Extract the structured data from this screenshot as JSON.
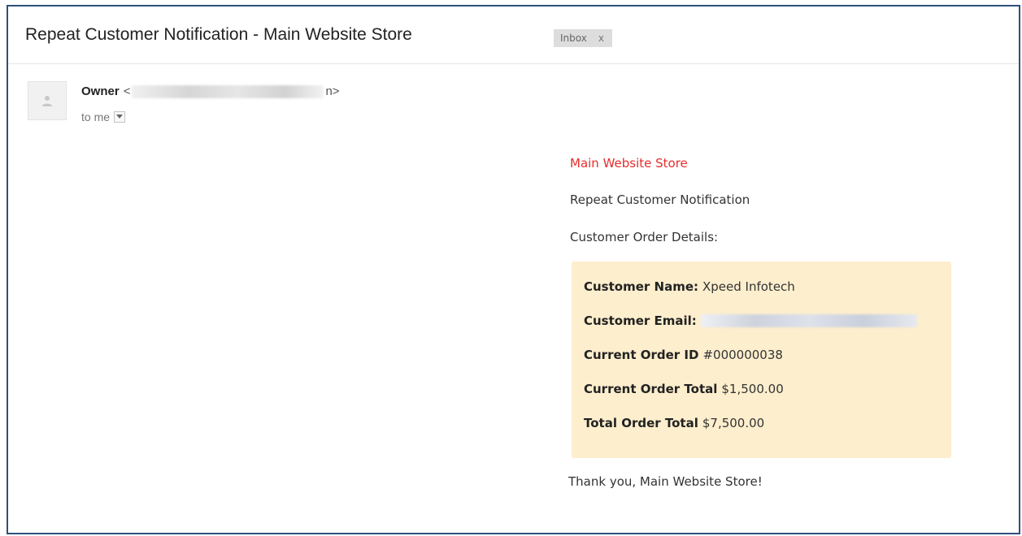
{
  "header": {
    "subject": "Repeat Customer Notification - Main Website Store",
    "label": "Inbox",
    "label_close": "x"
  },
  "sender": {
    "name": "Owner",
    "open_bracket": "<",
    "email_tail": "n>",
    "recipient": "to me"
  },
  "icons": {
    "avatar": "person-icon",
    "details_toggle": "chevron-down-icon"
  },
  "message": {
    "store_name": "Main Website Store",
    "title": "Repeat Customer Notification",
    "details_heading": "Customer Order Details:",
    "details": {
      "customer_name_label": "Customer Name:",
      "customer_name": "Xpeed Infotech",
      "customer_email_label": "Customer Email:",
      "current_order_id_label": "Current Order ID",
      "current_order_id": "#000000038",
      "current_order_total_label": "Current Order Total",
      "current_order_total": "$1,500.00",
      "total_order_total_label": "Total Order Total",
      "total_order_total": "$7,500.00"
    },
    "closing": "Thank you, Main Website Store!"
  },
  "colors": {
    "frame_border": "#2f4f7a",
    "store_link": "#e62d2d",
    "details_background": "#fdeecd",
    "label_chip": "#dddddd"
  }
}
